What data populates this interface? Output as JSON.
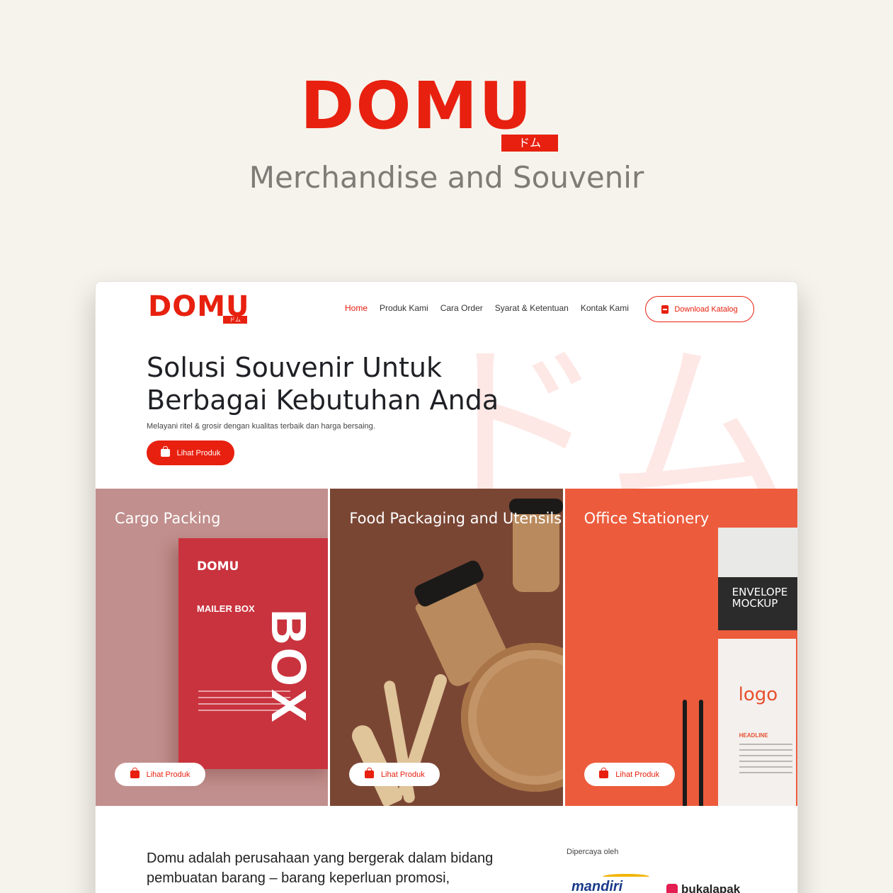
{
  "showcase": {
    "brand_name": "DOMU",
    "brand_katakana": "ドム",
    "tagline": "Merchandise and Souvenir"
  },
  "colors": {
    "brand_red": "#e8200f",
    "background": "#f6f3ec"
  },
  "nav": {
    "logo_text": "DOMU",
    "logo_katakana": "ドム",
    "links": [
      "Home",
      "Produk Kami",
      "Cara Order",
      "Syarat & Ketentuan",
      "Kontak Kami"
    ],
    "active_link": "Home",
    "cta_label": "Download Katalog",
    "cta_icon": "document-icon"
  },
  "hero": {
    "title": "Solusi Souvenir Untuk Berbagai Kebutuhan Anda",
    "subtitle": "Melayani ritel & grosir dengan kualitas terbaik dan harga bersaing.",
    "button_label": "Lihat Produk",
    "button_icon": "shopping-bag-icon",
    "background_katakana": "ドム"
  },
  "categories": [
    {
      "title": "Cargo Packing",
      "button_label": "Lihat Produk",
      "mockup": {
        "logo": "DOMU",
        "label": "MAILER BOX",
        "big_text": "BOX"
      }
    },
    {
      "title": "Food Packaging and Utensils",
      "button_label": "Lihat Produk"
    },
    {
      "title": "Office Stationery",
      "button_label": "Lihat Produk",
      "mockup": {
        "envelope_text": "ENVELOPE MOCKUP",
        "paper_logo": "logo",
        "paper_headline": "HEADLINE"
      }
    }
  ],
  "about": {
    "text": "Domu adalah perusahaan yang bergerak dalam bidang pembuatan barang – barang keperluan promosi,"
  },
  "partners": {
    "label": "Dipercaya oleh",
    "items": [
      "mandiri",
      "bukalapak"
    ]
  }
}
